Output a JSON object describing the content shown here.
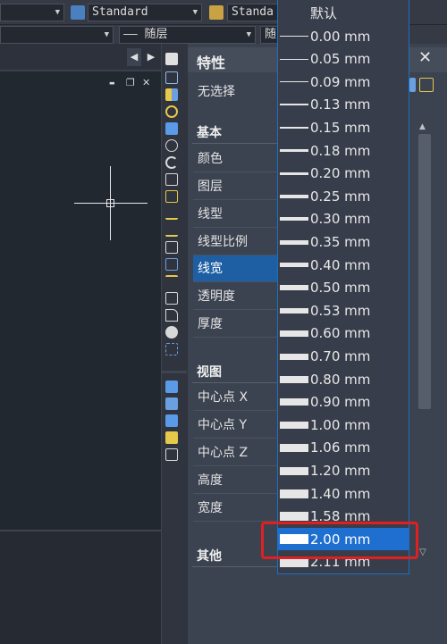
{
  "toolbar": {
    "style_combo": "Standard",
    "style_combo2": "Standa",
    "linetype_combo": "—— 随层",
    "linetype_combo2": "随"
  },
  "drawing_tab": {
    "prev": "◀",
    "next": "▶"
  },
  "window_controls": {
    "minimize": "▬",
    "restore": "❐",
    "close": "✕"
  },
  "properties": {
    "title": "特性",
    "close": "✕",
    "selection": "无选择",
    "sections": {
      "basic": "基本",
      "view": "视图",
      "other": "其他"
    },
    "basic_rows": [
      "颜色",
      "图层",
      "线型",
      "线型比例",
      "线宽",
      "透明度",
      "厚度"
    ],
    "view_rows": [
      "中心点 X",
      "中心点 Y",
      "中心点 Z",
      "高度",
      "宽度"
    ],
    "selected_row": "线宽"
  },
  "lineweight_dropdown": {
    "items": [
      "默认",
      "0.00 mm",
      "0.05 mm",
      "0.09 mm",
      "0.13 mm",
      "0.15 mm",
      "0.18 mm",
      "0.20 mm",
      "0.25 mm",
      "0.30 mm",
      "0.35 mm",
      "0.40 mm",
      "0.50 mm",
      "0.53 mm",
      "0.60 mm",
      "0.70 mm",
      "0.80 mm",
      "0.90 mm",
      "1.00 mm",
      "1.06 mm",
      "1.20 mm",
      "1.40 mm",
      "1.58 mm",
      "2.00 mm",
      "2.11 mm"
    ],
    "selected": "2.00 mm"
  },
  "colors": {
    "selection_blue": "#1e6fd0",
    "highlight_red": "#e02020",
    "panel_bg": "#3b4250"
  }
}
